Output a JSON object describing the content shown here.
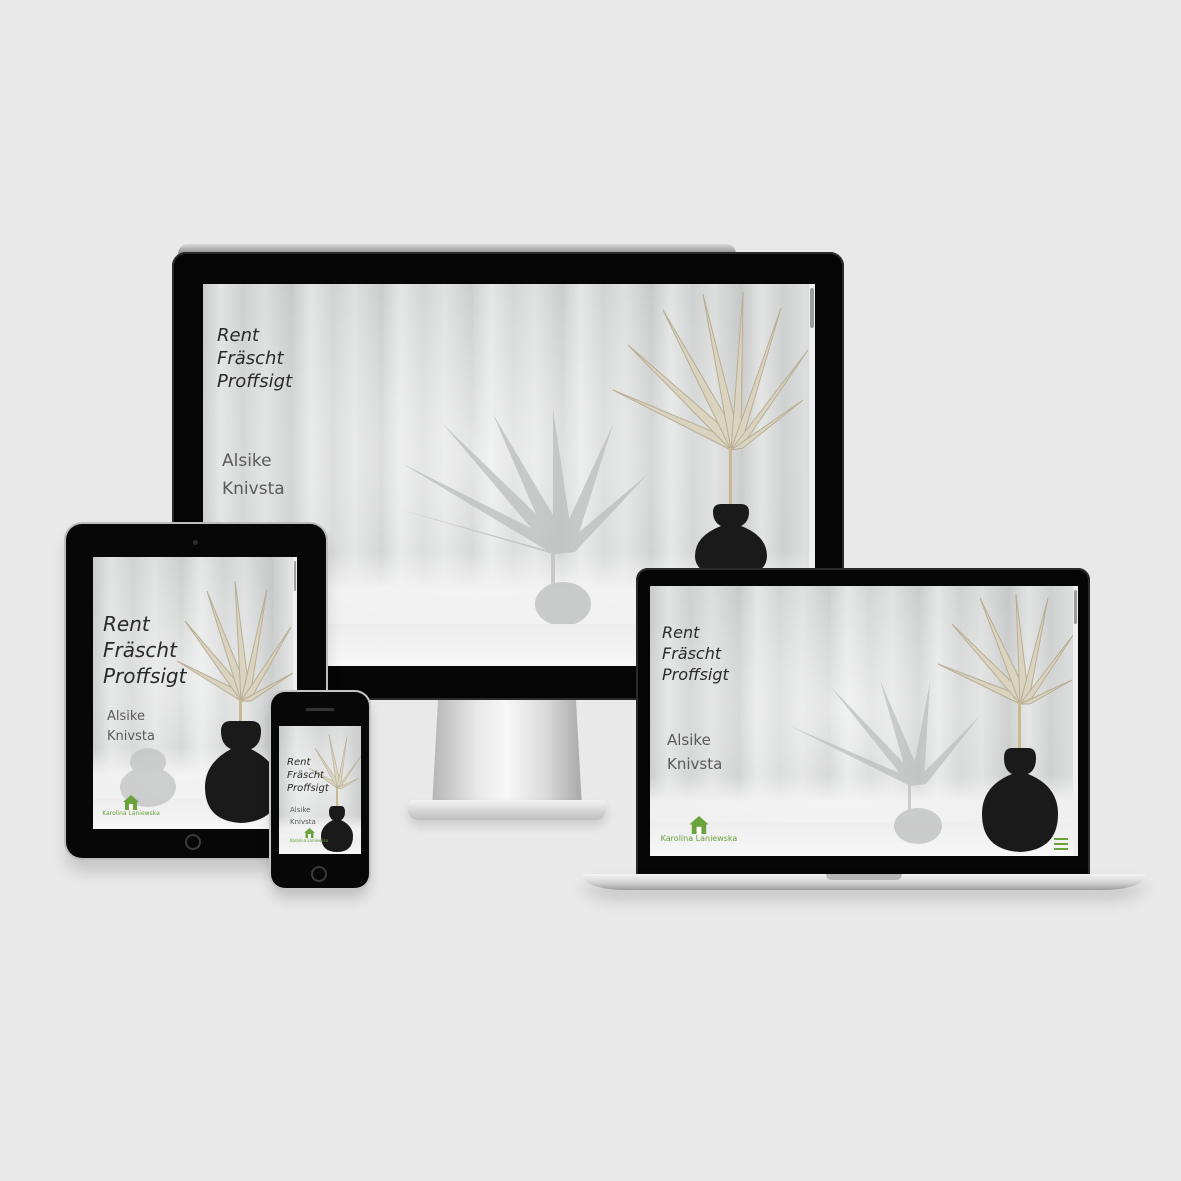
{
  "hero": {
    "headline": [
      "Rent",
      "Fräscht",
      "Proffsigt"
    ],
    "locations": [
      "Alsike",
      "Knivsta"
    ]
  },
  "logo": {
    "name": "Karolina Laniewska",
    "icon": "house-icon"
  },
  "menu": {
    "icon": "hamburger-menu-icon"
  },
  "colors": {
    "background": "#e9e9e9",
    "device_frame": "#050505",
    "brand_green": "#6aa23b",
    "headline_text": "#2a2a2a",
    "vase": "#1a1a1a",
    "leaf": "#d9d3c0"
  }
}
